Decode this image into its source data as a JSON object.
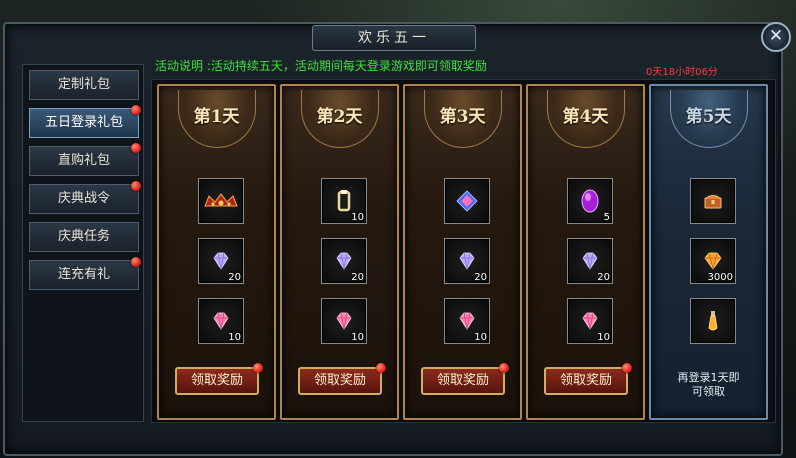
{
  "window": {
    "title": "欢乐五一",
    "close_label": "✕"
  },
  "description": "活动说明 :活动持续五天，活动期间每天登录游戏即可领取奖励",
  "timer": "0天18小时06分",
  "sidebar": {
    "items": [
      {
        "label": "定制礼包",
        "active": false,
        "badge": false
      },
      {
        "label": "五日登录礼包",
        "active": true,
        "badge": true
      },
      {
        "label": "直购礼包",
        "active": false,
        "badge": true
      },
      {
        "label": "庆典战令",
        "active": false,
        "badge": true
      },
      {
        "label": "庆典任务",
        "active": false,
        "badge": false
      },
      {
        "label": "连充有礼",
        "active": false,
        "badge": true
      }
    ]
  },
  "days": [
    {
      "label": "第1天",
      "state": "claimable",
      "button": "领取奖励",
      "rewards": [
        {
          "icon": "crown-icon",
          "qty": ""
        },
        {
          "icon": "purple-diamond-icon",
          "qty": "20"
        },
        {
          "icon": "pink-diamond-icon",
          "qty": "10"
        }
      ]
    },
    {
      "label": "第2天",
      "state": "claimable",
      "button": "领取奖励",
      "rewards": [
        {
          "icon": "ring-icon",
          "qty": "10"
        },
        {
          "icon": "purple-diamond-icon",
          "qty": "20"
        },
        {
          "icon": "pink-diamond-icon",
          "qty": "10"
        }
      ]
    },
    {
      "label": "第3天",
      "state": "claimable",
      "button": "领取奖励",
      "rewards": [
        {
          "icon": "blue-pink-gem-icon",
          "qty": ""
        },
        {
          "icon": "purple-diamond-icon",
          "qty": "20"
        },
        {
          "icon": "pink-diamond-icon",
          "qty": "10"
        }
      ]
    },
    {
      "label": "第4天",
      "state": "claimable",
      "button": "领取奖励",
      "rewards": [
        {
          "icon": "purple-orb-icon",
          "qty": "5"
        },
        {
          "icon": "purple-diamond-icon",
          "qty": "20"
        },
        {
          "icon": "pink-diamond-icon",
          "qty": "10"
        }
      ]
    },
    {
      "label": "第5天",
      "state": "locked",
      "note": "再登录1天即\n可领取",
      "rewards": [
        {
          "icon": "chest-icon",
          "qty": ""
        },
        {
          "icon": "orange-diamond-icon",
          "qty": "3000"
        },
        {
          "icon": "potion-icon",
          "qty": ""
        }
      ]
    }
  ],
  "colors": {
    "description": "#3fe03f",
    "timer": "#ff3b3b",
    "badge": "#e0241a",
    "button_border": "#d3ad62"
  }
}
